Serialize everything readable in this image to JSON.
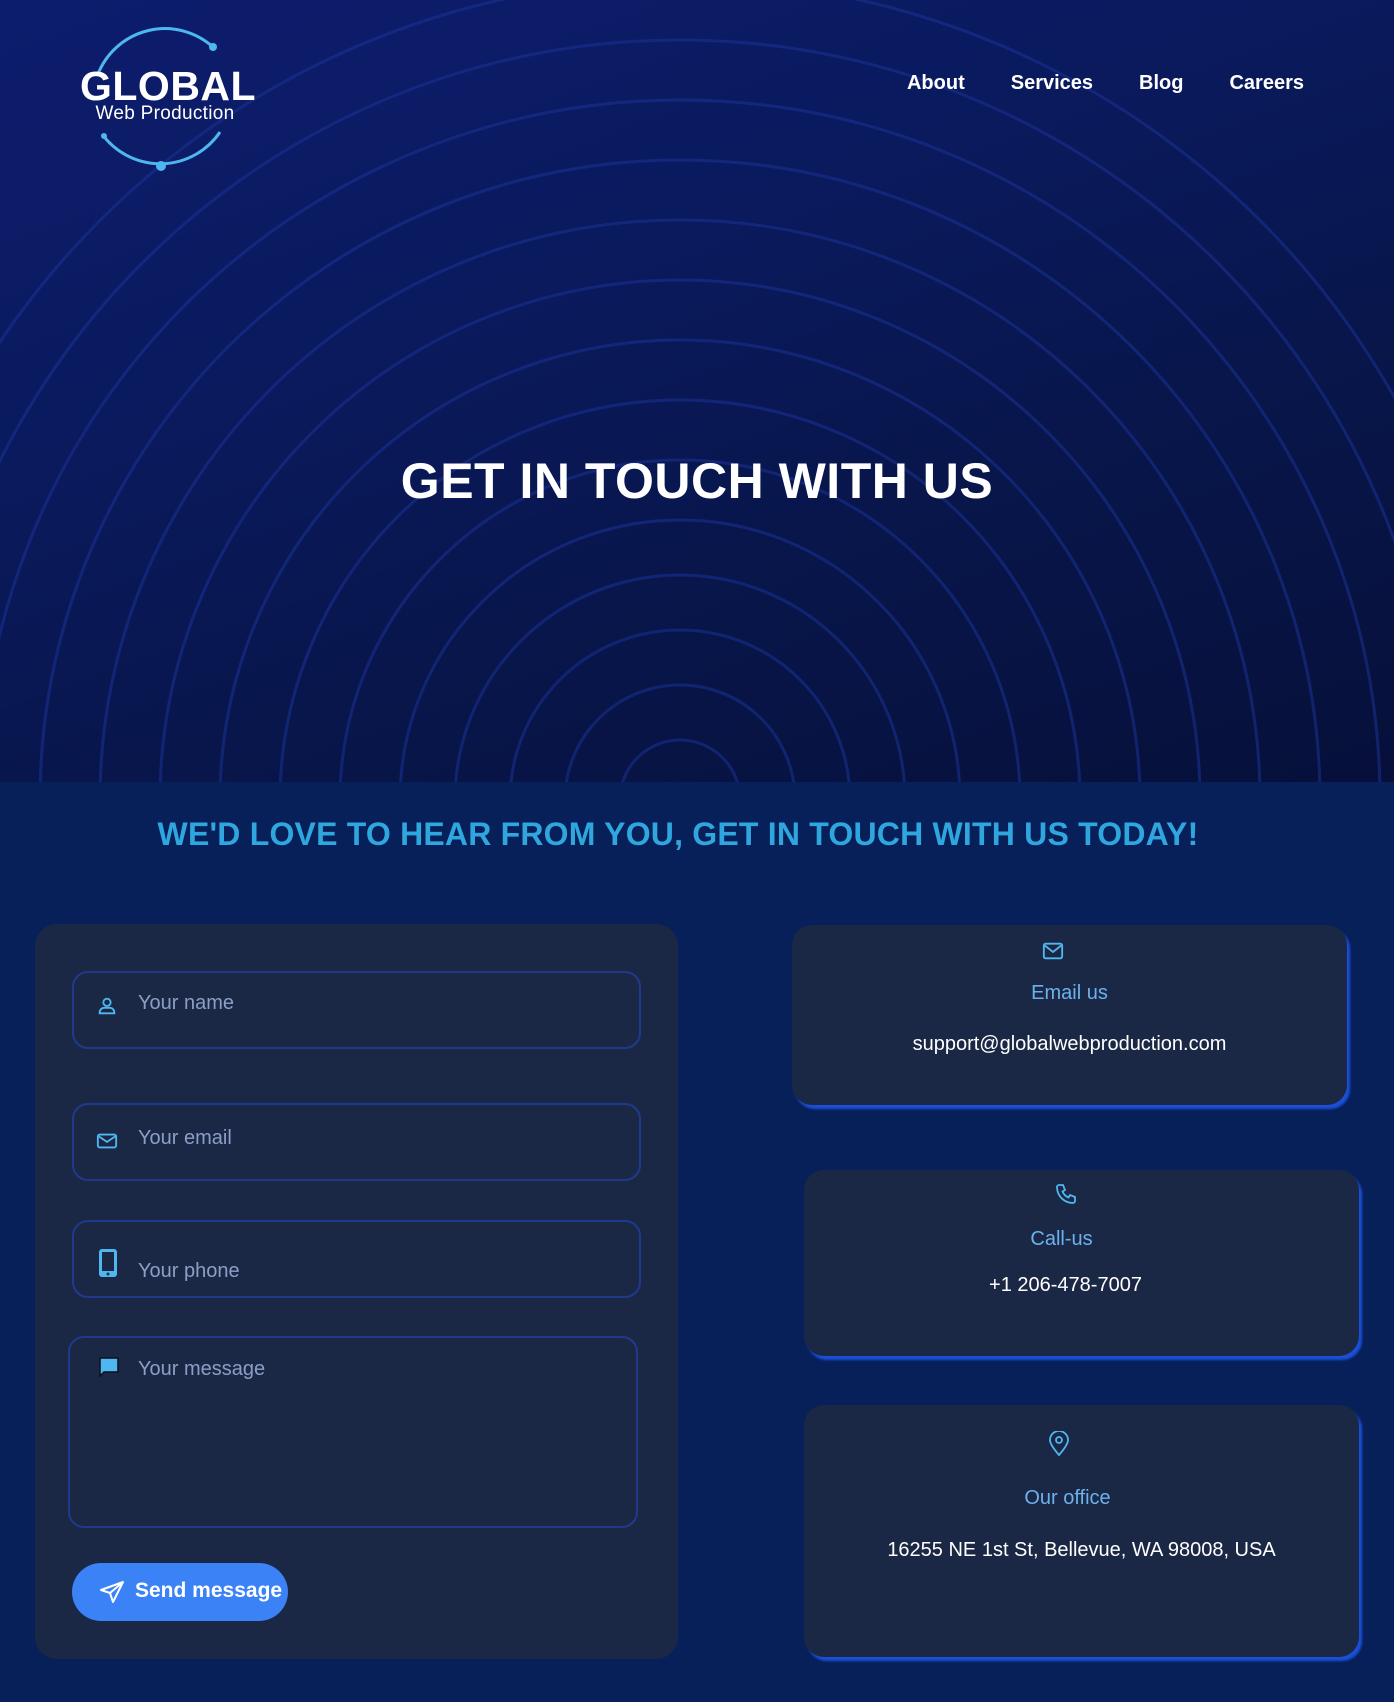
{
  "brand": {
    "logo_word": "GLOBAL",
    "logo_sub": "Web Production",
    "accent": "#4fb7f0"
  },
  "nav": {
    "items": [
      {
        "label": "About"
      },
      {
        "label": "Services"
      },
      {
        "label": "Blog"
      },
      {
        "label": "Careers"
      }
    ]
  },
  "hero": {
    "title": "GET IN TOUCH WITH US",
    "background": "#0a1a5e"
  },
  "subheading": "WE'D LOVE TO HEAR FROM YOU, GET IN TOUCH WITH US TODAY!",
  "form": {
    "name": {
      "placeholder": "Your name",
      "value": "",
      "icon": "user-icon"
    },
    "email": {
      "placeholder": "Your email",
      "value": "",
      "icon": "mail-icon"
    },
    "phone": {
      "placeholder": "Your phone",
      "value": "",
      "icon": "smartphone-icon"
    },
    "message": {
      "placeholder": "Your message",
      "value": "",
      "icon": "chat-bubble-icon"
    },
    "submit_label": "Send message",
    "submit_icon": "send-icon",
    "button_color": "#3b82f6"
  },
  "contact": {
    "email": {
      "title": "Email us",
      "value": "support@globalwebproduction.com",
      "icon": "mail-icon"
    },
    "phone": {
      "title": "Call-us",
      "value": "+1 206-478-7007",
      "icon": "phone-icon"
    },
    "office": {
      "title": "Our office",
      "value": "16255 NE 1st St, Bellevue, WA 98008, USA",
      "icon": "map-pin-icon"
    }
  },
  "colors": {
    "page_bg": "#07205a",
    "card_bg": "#1b2845",
    "heading_accent": "#2fa6dd",
    "card_title": "#6cb1ee",
    "field_border": "#1f3a8c",
    "card_shadow": "#1b4fd8"
  }
}
